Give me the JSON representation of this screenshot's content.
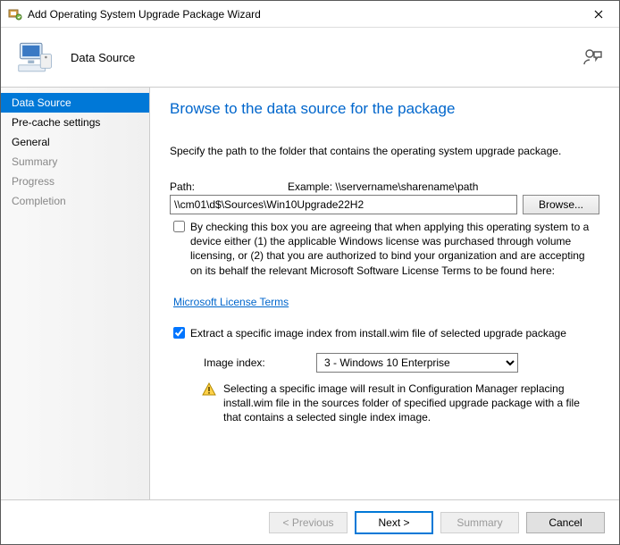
{
  "window": {
    "title": "Add Operating System Upgrade Package Wizard"
  },
  "header": {
    "title": "Data Source"
  },
  "sidebar": {
    "items": [
      {
        "label": "Data Source",
        "selected": true,
        "dim": false
      },
      {
        "label": "Pre-cache settings",
        "selected": false,
        "dim": false
      },
      {
        "label": "General",
        "selected": false,
        "dim": false
      },
      {
        "label": "Summary",
        "selected": false,
        "dim": true
      },
      {
        "label": "Progress",
        "selected": false,
        "dim": true
      },
      {
        "label": "Completion",
        "selected": false,
        "dim": true
      }
    ]
  },
  "page": {
    "title": "Browse to the data source for the package",
    "instruction": "Specify the path to the folder that contains the operating system upgrade package.",
    "path_label": "Path:",
    "path_example": "Example:  \\\\servername\\sharename\\path",
    "path_value": "\\\\cm01\\d$\\Sources\\Win10Upgrade22H2",
    "browse": "Browse...",
    "agree_text": "By checking this box you are agreeing that when applying this operating system to a device either (1) the applicable Windows license was purchased through volume licensing, or (2) that you are authorized to bind your organization and are accepting on its behalf the relevant Microsoft Software License Terms to be found here:",
    "agree_checked": false,
    "license_link": "Microsoft License Terms",
    "extract_text": "Extract a specific image index from install.wim file of selected upgrade package",
    "extract_checked": true,
    "index_label": "Image index:",
    "index_value": "3 - Windows 10 Enterprise",
    "warn_text": "Selecting a specific image will result in Configuration Manager replacing install.wim file in the sources folder of specified upgrade package with a file that contains a selected single index image."
  },
  "footer": {
    "previous": "< Previous",
    "next": "Next >",
    "summary": "Summary",
    "cancel": "Cancel"
  }
}
